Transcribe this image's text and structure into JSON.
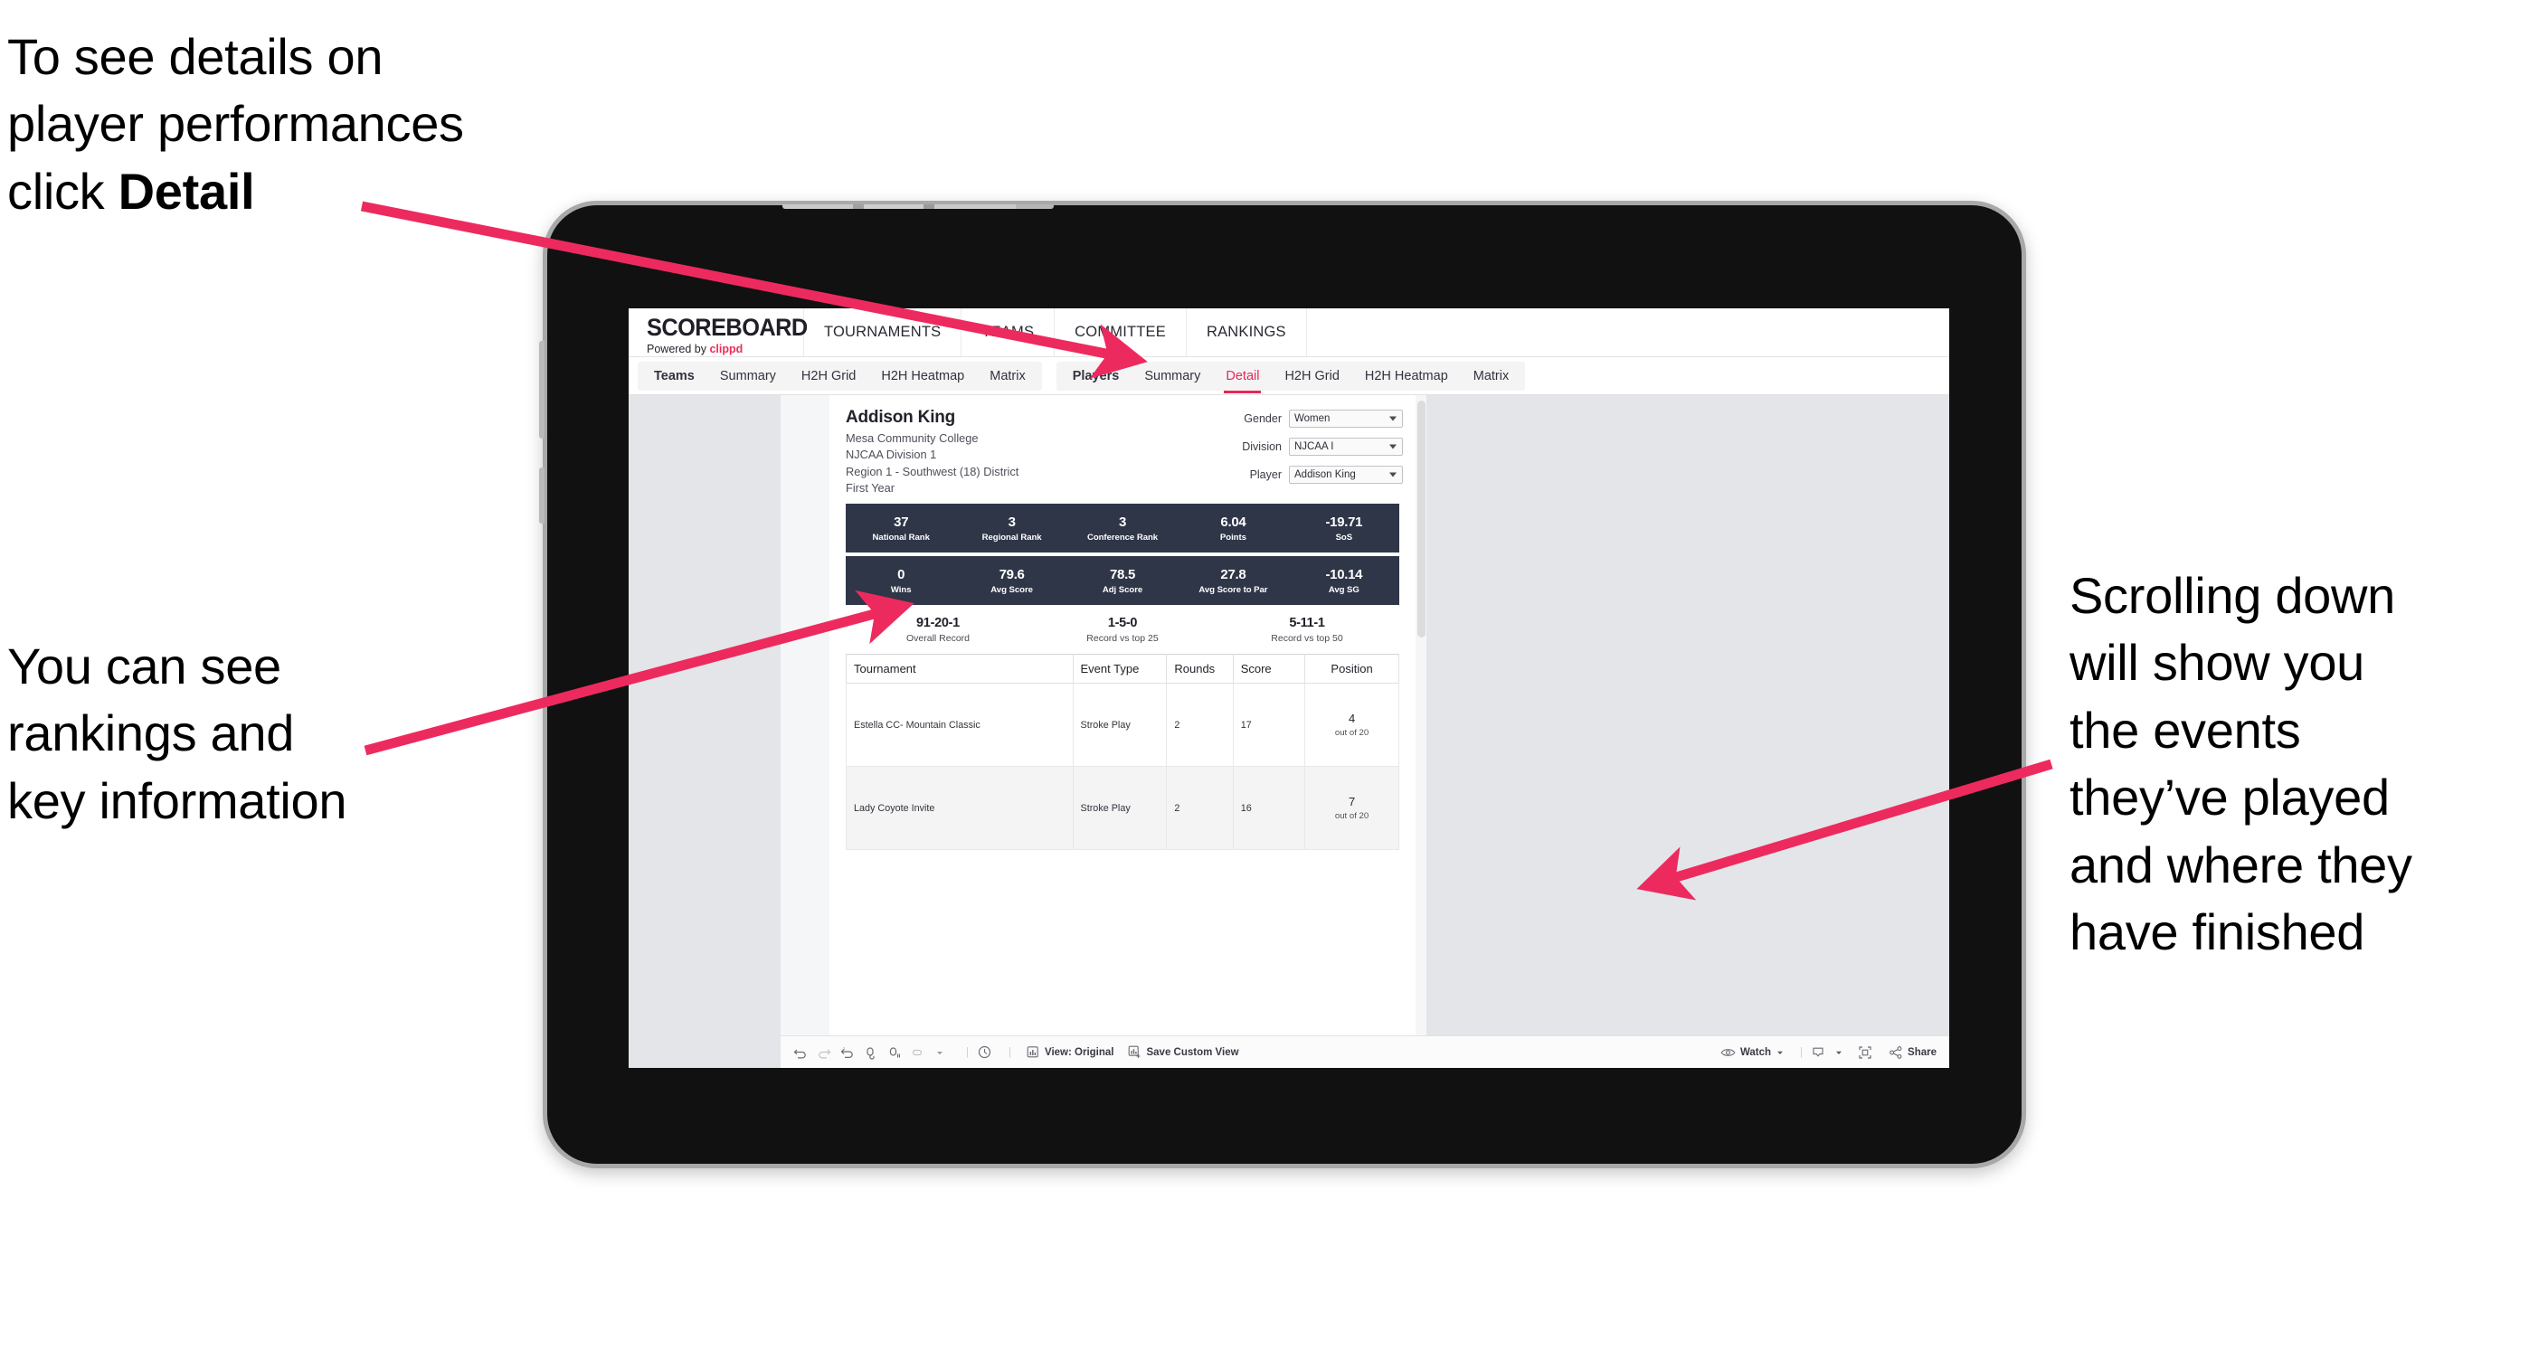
{
  "annotations": {
    "top_left": "To see details on\nplayer performances\nclick ",
    "top_left_bold": "Detail",
    "mid_left": "You can see\nrankings and\nkey information",
    "right": "Scrolling down\nwill show you\nthe events\nthey’ve played\nand where they\nhave finished",
    "arrow_color": "#ED2A5E"
  },
  "app": {
    "brand": {
      "title": "SCOREBOARD",
      "powered_prefix": "Powered by ",
      "powered_name": "clippd"
    },
    "topnav": [
      "TOURNAMENTS",
      "TEAMS",
      "COMMITTEE",
      "RANKINGS"
    ],
    "subnav_teams": [
      "Teams",
      "Summary",
      "H2H Grid",
      "H2H Heatmap",
      "Matrix"
    ],
    "subnav_players": [
      "Players",
      "Summary",
      "Detail",
      "H2H Grid",
      "H2H Heatmap",
      "Matrix"
    ],
    "active_tab": "Detail",
    "accent": "#E8275A",
    "stat_bar_bg": "#2F3648"
  },
  "player": {
    "name": "Addison King",
    "school": "Mesa Community College",
    "division": "NJCAA Division 1",
    "region": "Region 1 - Southwest (18) District",
    "class_year": "First Year"
  },
  "filters": [
    {
      "label": "Gender",
      "value": "Women"
    },
    {
      "label": "Division",
      "value": "NJCAA I"
    },
    {
      "label": "Player",
      "value": "Addison King"
    }
  ],
  "stats_row1": [
    {
      "value": "37",
      "label": "National Rank"
    },
    {
      "value": "3",
      "label": "Regional Rank"
    },
    {
      "value": "3",
      "label": "Conference Rank"
    },
    {
      "value": "6.04",
      "label": "Points"
    },
    {
      "value": "-19.71",
      "label": "SoS"
    }
  ],
  "stats_row2": [
    {
      "value": "0",
      "label": "Wins"
    },
    {
      "value": "79.6",
      "label": "Avg Score"
    },
    {
      "value": "78.5",
      "label": "Adj Score"
    },
    {
      "value": "27.8",
      "label": "Avg Score to Par"
    },
    {
      "value": "-10.14",
      "label": "Avg SG"
    }
  ],
  "records": [
    {
      "value": "91-20-1",
      "label": "Overall Record"
    },
    {
      "value": "1-5-0",
      "label": "Record vs top 25"
    },
    {
      "value": "5-11-1",
      "label": "Record vs top 50"
    }
  ],
  "events_table": {
    "headers": [
      "Tournament",
      "Event Type",
      "Rounds",
      "Score",
      "Position"
    ],
    "rows": [
      {
        "tournament": "Estella CC- Mountain Classic",
        "event_type": "Stroke Play",
        "rounds": "2",
        "score": "17",
        "position_num": "4",
        "position_of": "out of 20"
      },
      {
        "tournament": "Lady Coyote Invite",
        "event_type": "Stroke Play",
        "rounds": "2",
        "score": "16",
        "position_num": "7",
        "position_of": "out of 20"
      }
    ]
  },
  "toolbar": {
    "view_label": "View: Original",
    "save_label": "Save Custom View",
    "watch_label": "Watch",
    "share_label": "Share",
    "icons": [
      "undo-icon",
      "redo-icon",
      "revert-icon",
      "refresh-icon",
      "pause-icon",
      "highlight-icon",
      "caret-down-icon",
      "clock-icon",
      "view-original-icon",
      "save-view-icon",
      "eye-icon",
      "download-icon",
      "fullscreen-icon",
      "share-icon"
    ]
  }
}
